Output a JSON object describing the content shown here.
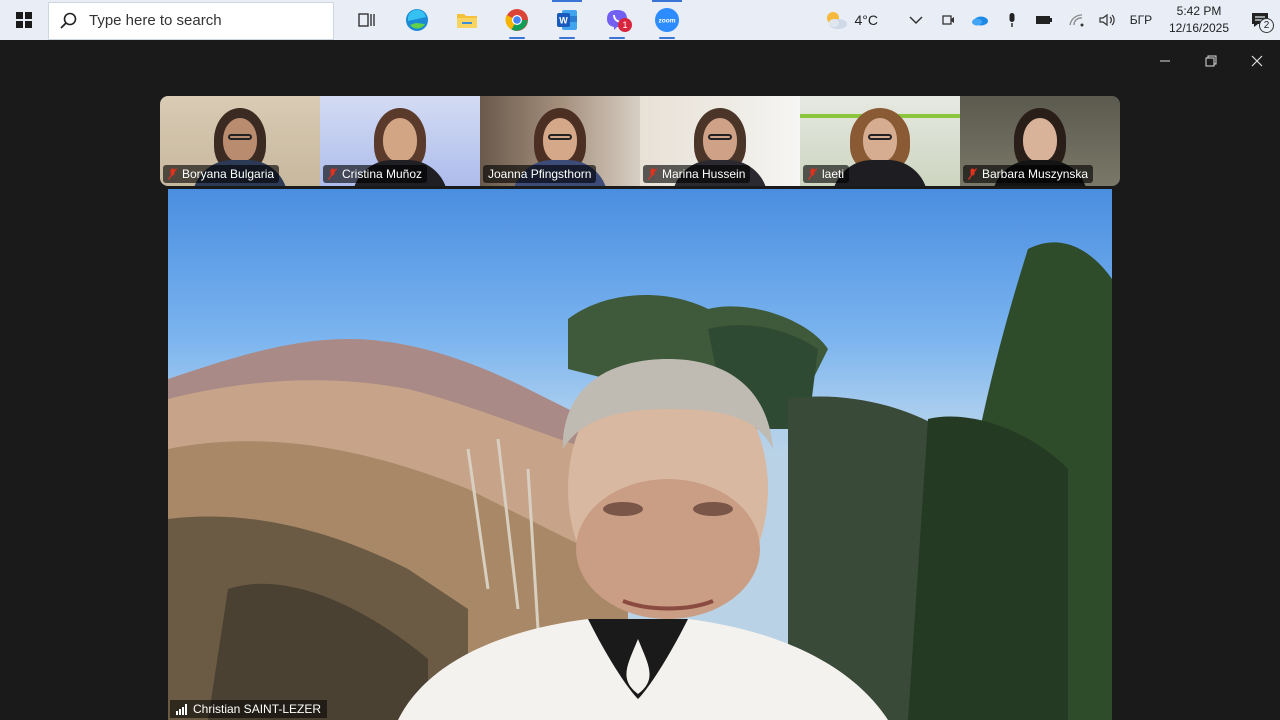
{
  "taskbar": {
    "search_placeholder": "Type here to search",
    "apps": [
      {
        "name": "task-view",
        "active": false
      },
      {
        "name": "edge",
        "active": false
      },
      {
        "name": "file-explorer",
        "active": false
      },
      {
        "name": "chrome",
        "active": true
      },
      {
        "name": "word",
        "active": true
      },
      {
        "name": "viber",
        "active": true,
        "badge": "1"
      },
      {
        "name": "zoom",
        "active": true
      }
    ],
    "weather": {
      "temperature": "4°C",
      "icon": "partly-cloudy-icon"
    },
    "language": "БГР",
    "time": "5:42 PM",
    "date": "12/16/2025",
    "notification_count": "2"
  },
  "meeting": {
    "participants": [
      {
        "name": "Boryana Bulgaria",
        "muted": true
      },
      {
        "name": "Cristina Muñoz",
        "muted": true
      },
      {
        "name": "Joanna Pfingsthorn",
        "muted": false
      },
      {
        "name": "Marina Hussein",
        "muted": true
      },
      {
        "name": "laeti",
        "muted": true
      },
      {
        "name": "Barbara Muszynska",
        "muted": true
      }
    ],
    "active_speaker": "Christian SAINT-LEZER"
  },
  "colors": {
    "taskbar_bg": "#e8edf6",
    "window_bg": "#1a1a1a",
    "accent": "#3b74d6",
    "mute_red": "#e0301e"
  }
}
